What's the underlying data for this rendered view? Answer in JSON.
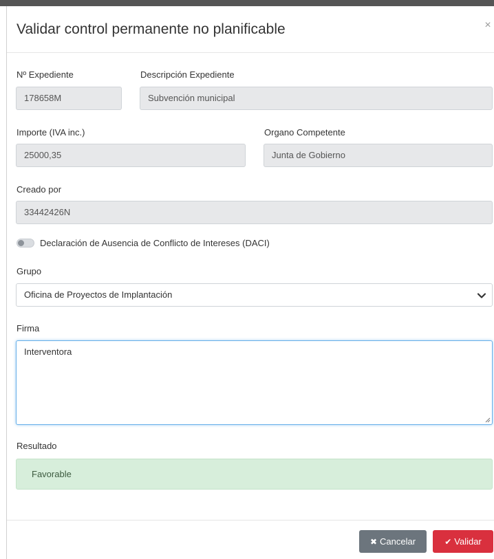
{
  "dialog": {
    "title": "Validar control permanente no planificable",
    "close_symbol": "×"
  },
  "fields": {
    "expediente": {
      "label": "Nº Expediente",
      "value": "178658M"
    },
    "descripcion": {
      "label": "Descripción Expediente",
      "value": "Subvención municipal"
    },
    "importe": {
      "label": "Importe (IVA inc.)",
      "value": "25000,35"
    },
    "organo": {
      "label": "Organo Competente",
      "value": "Junta de Gobierno"
    },
    "creado": {
      "label": "Creado por",
      "value": "33442426N"
    }
  },
  "daci": {
    "label": "Declaración de Ausencia de Conflicto de Intereses (DACI)",
    "enabled": false
  },
  "grupo": {
    "label": "Grupo",
    "selected": "Oficina de Proyectos de Implantación"
  },
  "firma": {
    "label": "Firma",
    "value": "Interventora"
  },
  "resultado": {
    "label": "Resultado",
    "value": "Favorable",
    "color": "#d7eedb"
  },
  "footer": {
    "cancel_label": "Cancelar",
    "validate_label": "Validar",
    "cancel_icon": "times-icon",
    "validate_icon": "check-icon",
    "cancel_color": "#6c757d",
    "validate_color": "#d9303e"
  }
}
